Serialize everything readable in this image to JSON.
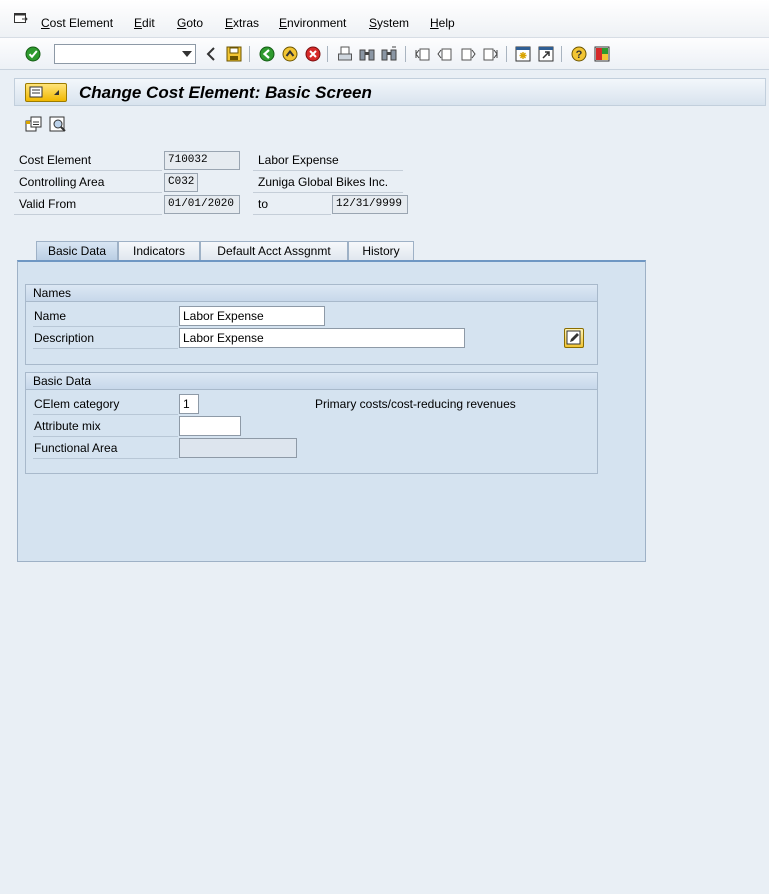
{
  "menubar": {
    "items": [
      "Cost Element",
      "Edit",
      "Goto",
      "Extras",
      "Environment",
      "System",
      "Help"
    ]
  },
  "toolbar": {
    "command_field_value": "",
    "icons": [
      "enter-icon",
      "back-icon",
      "save-icon",
      "green-back-icon",
      "exit-icon",
      "cancel-icon",
      "print-icon",
      "find-icon",
      "find-next-icon",
      "first-page-icon",
      "previous-page-icon",
      "next-page-icon",
      "last-page-icon",
      "create-session-icon",
      "shortcut-icon",
      "help-icon",
      "customize-layout-icon"
    ]
  },
  "title": {
    "text": "Change Cost Element: Basic Screen"
  },
  "header": {
    "cost_element_label": "Cost Element",
    "cost_element_value": "710032",
    "cost_element_text": "Labor Expense",
    "controlling_area_label": "Controlling Area",
    "controlling_area_value": "C032",
    "controlling_area_text": "Zuniga Global Bikes Inc.",
    "valid_from_label": "Valid From",
    "valid_from_value": "01/01/2020",
    "to_label": "to",
    "valid_to_value": "12/31/9999"
  },
  "tabs": [
    {
      "label": "Basic Data",
      "active": true
    },
    {
      "label": "Indicators",
      "active": false
    },
    {
      "label": "Default Acct Assgnmt",
      "active": false
    },
    {
      "label": "History",
      "active": false
    }
  ],
  "names_group": {
    "title": "Names",
    "name_label": "Name",
    "name_value": "Labor Expense",
    "description_label": "Description",
    "description_value": "Labor Expense"
  },
  "basic_group": {
    "title": "Basic Data",
    "category_label": "CElem category",
    "category_value": "1",
    "category_text": "Primary costs/cost-reducing revenues",
    "attribute_mix_label": "Attribute mix",
    "attribute_mix_value": "",
    "functional_area_label": "Functional Area",
    "functional_area_value": ""
  }
}
